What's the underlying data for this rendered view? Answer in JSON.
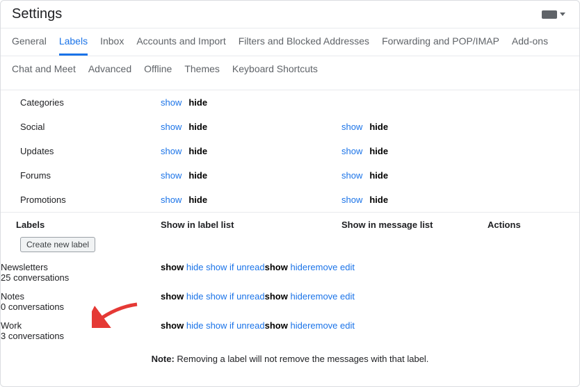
{
  "title": "Settings",
  "tabs_row1": [
    "General",
    "Labels",
    "Inbox",
    "Accounts and Import",
    "Filters and Blocked Addresses",
    "Forwarding and POP/IMAP",
    "Add-ons"
  ],
  "tabs_row2": [
    "Chat and Meet",
    "Advanced",
    "Offline",
    "Themes",
    "Keyboard Shortcuts"
  ],
  "active_tab": "Labels",
  "system_rows": [
    {
      "name": "Categories",
      "list_show": "show",
      "list_hide": "hide",
      "msg_show": null,
      "msg_hide": null
    },
    {
      "name": "Social",
      "list_show": "show",
      "list_hide": "hide",
      "msg_show": "show",
      "msg_hide": "hide"
    },
    {
      "name": "Updates",
      "list_show": "show",
      "list_hide": "hide",
      "msg_show": "show",
      "msg_hide": "hide"
    },
    {
      "name": "Forums",
      "list_show": "show",
      "list_hide": "hide",
      "msg_show": "show",
      "msg_hide": "hide"
    },
    {
      "name": "Promotions",
      "list_show": "show",
      "list_hide": "hide",
      "msg_show": "show",
      "msg_hide": "hide"
    }
  ],
  "labels_header": {
    "labels": "Labels",
    "list": "Show in label list",
    "msg": "Show in message list",
    "actions": "Actions"
  },
  "create_label_btn": "Create new label",
  "user_labels": [
    {
      "name": "Newsletters",
      "count": "25 conversations",
      "list_show": "show",
      "list_hide": "hide",
      "list_unread": "show if unread",
      "msg_show": "show",
      "msg_hide": "hide",
      "remove": "remove",
      "edit": "edit"
    },
    {
      "name": "Notes",
      "count": "0 conversations",
      "list_show": "show",
      "list_hide": "hide",
      "list_unread": "show if unread",
      "msg_show": "show",
      "msg_hide": "hide",
      "remove": "remove",
      "edit": "edit"
    },
    {
      "name": "Work",
      "count": "3 conversations",
      "list_show": "show",
      "list_hide": "hide",
      "list_unread": "show if unread",
      "msg_show": "show",
      "msg_hide": "hide",
      "remove": "remove",
      "edit": "edit"
    }
  ],
  "note_label": "Note:",
  "note_text": " Removing a label will not remove the messages with that label."
}
